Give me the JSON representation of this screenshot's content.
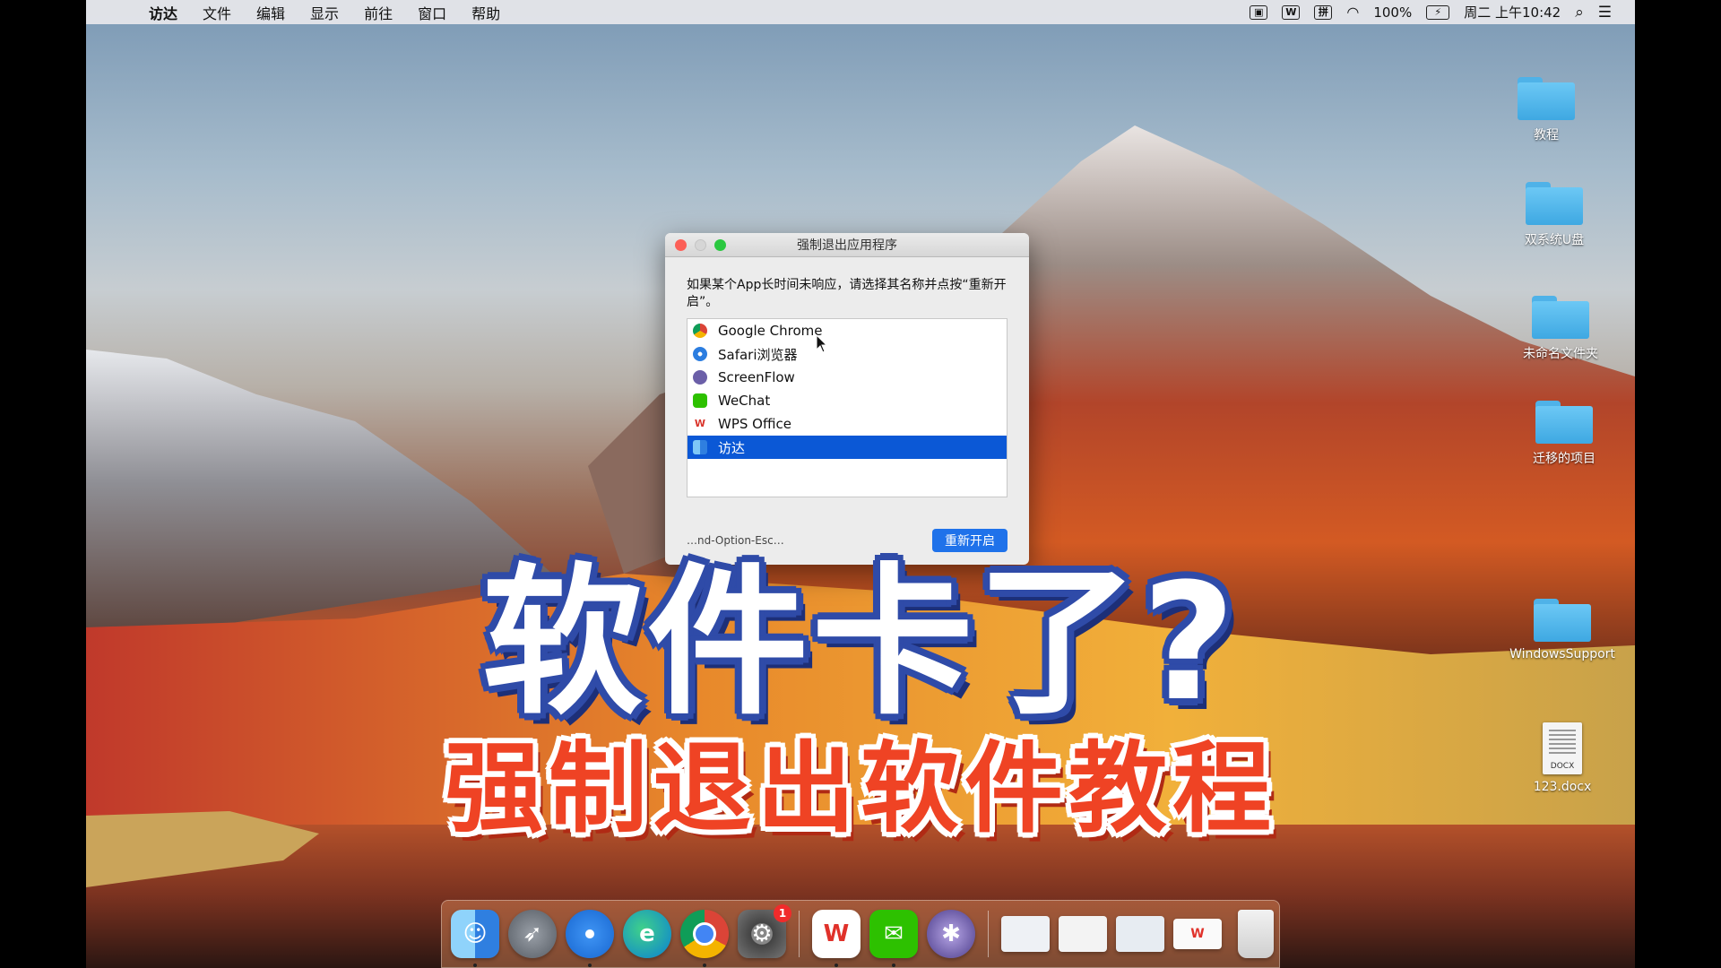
{
  "menubar": {
    "items": [
      "访达",
      "文件",
      "编辑",
      "显示",
      "前往",
      "窗口",
      "帮助"
    ],
    "status": {
      "input_method": "拼",
      "wps_icon": "W",
      "battery": "100%",
      "clock": "周二 上午10:42"
    }
  },
  "desktop": {
    "items": [
      "教程",
      "双系统U盘",
      "未命名文件夹",
      "迁移的项目",
      "WindowsSupport",
      "123.docx"
    ],
    "docx_tag": "DOCX"
  },
  "dialog": {
    "title": "强制退出应用程序",
    "message": "如果某个App长时间未响应，请选择其名称并点按“重新开启”。",
    "apps": [
      "Google Chrome",
      "Safari浏览器",
      "ScreenFlow",
      "WeChat",
      "WPS Office",
      "访达"
    ],
    "selected_index": 5,
    "footer_hint": "…nd-Option-Esc…",
    "relaunch_label": "重新开启"
  },
  "overlay": {
    "headline": "软件卡了?",
    "subtitle": "强制退出软件教程"
  },
  "dock": {
    "system_preferences_badge": "1"
  },
  "colors": {
    "selection": "#0b58d6",
    "headline_outline": "#2f4ba8",
    "subtitle_fill": "#ef4324"
  }
}
